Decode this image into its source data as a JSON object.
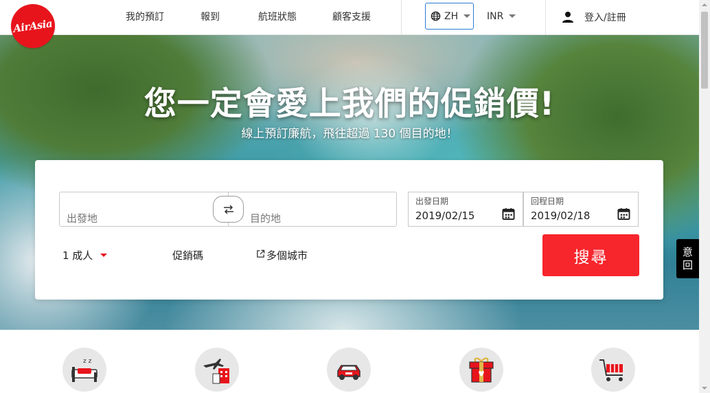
{
  "brand": {
    "logo_text": "AirAsia",
    "accent": "#e8141c",
    "search_button_color": "#f7252c"
  },
  "header": {
    "nav": [
      "我的預訂",
      "報到",
      "航班狀態",
      "顧客支援"
    ],
    "language": "ZH",
    "currency": "INR",
    "login_label": "登入/註冊"
  },
  "hero": {
    "title": "您一定會愛上我們的促銷價!",
    "subtitle": "線上預訂廉航，飛往超過 130 個目的地！"
  },
  "search": {
    "origin_placeholder": "出發地",
    "destination_placeholder": "目的地",
    "depart_label": "出發日期",
    "depart_date": "2019/02/15",
    "return_label": "回程日期",
    "return_date": "2019/02/18",
    "passengers": "1 成人",
    "promo_code": "促銷碼",
    "multi_city": "多個城市",
    "search_button": "搜尋"
  },
  "side_tab": {
    "line1": "意",
    "line2": "回"
  },
  "features": [
    {
      "icon": "hotel-icon"
    },
    {
      "icon": "flight-hotel-icon"
    },
    {
      "icon": "car-icon"
    },
    {
      "icon": "gift-icon"
    },
    {
      "icon": "shopping-cart-icon"
    }
  ]
}
